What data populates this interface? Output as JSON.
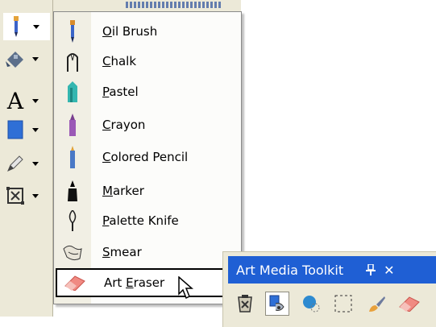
{
  "toolbox": {
    "tools": [
      {
        "name": "art-media-tool",
        "icon": "brush-icon"
      },
      {
        "name": "fill-tool",
        "icon": "paint-bucket-icon"
      },
      {
        "name": "text-tool",
        "icon": "text-a-icon",
        "glyph": "A"
      },
      {
        "name": "rectangle-tool",
        "icon": "rectangle-icon"
      },
      {
        "name": "eyedropper-tool",
        "icon": "pen-icon"
      },
      {
        "name": "transform-tool",
        "icon": "transform-icon"
      }
    ]
  },
  "menu": {
    "items": [
      {
        "pre": "",
        "ul": "O",
        "post": "il Brush",
        "icon": "oil-brush-icon"
      },
      {
        "pre": "",
        "ul": "C",
        "post": "halk",
        "icon": "chalk-icon"
      },
      {
        "pre": "",
        "ul": "P",
        "post": "astel",
        "icon": "pastel-icon"
      },
      {
        "pre": "",
        "ul": "C",
        "post": "rayon",
        "icon": "crayon-icon"
      },
      {
        "pre": "",
        "ul": "C",
        "post": "olored Pencil",
        "icon": "colored-pencil-icon"
      },
      {
        "pre": "",
        "ul": "M",
        "post": "arker",
        "icon": "marker-icon"
      },
      {
        "pre": "",
        "ul": "P",
        "post": "alette Knife",
        "icon": "palette-knife-icon"
      },
      {
        "pre": "",
        "ul": "S",
        "post": "mear",
        "icon": "smear-icon"
      },
      {
        "pre": "Art ",
        "ul": "E",
        "post": "raser",
        "icon": "art-eraser-icon",
        "hot": true
      }
    ]
  },
  "docker": {
    "title": "Art Media Toolkit",
    "pin_glyph": "ᵖ",
    "close_glyph": "✕",
    "buttons": [
      "select-all-icon",
      "media-selector-icon",
      "blob-brush-icon",
      "marquee-select-icon",
      "brush-tool-icon",
      "eraser-icon"
    ]
  },
  "colors": {
    "chrome": "#ece9d8",
    "titlebar": "#1f5fd4",
    "menu_bg": "#fcfcfa"
  }
}
